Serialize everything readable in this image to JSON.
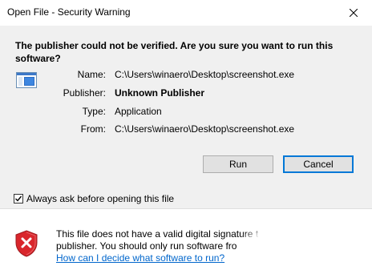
{
  "window": {
    "title": "Open File - Security Warning",
    "close_icon": "close-icon"
  },
  "headline": "The publisher could not be verified.  Are you sure you want to run this software?",
  "app_icon": "application-window-icon",
  "details": [
    {
      "label": "Name:",
      "value": "C:\\Users\\winaero\\Desktop\\screenshot.exe",
      "bold": false
    },
    {
      "label": "Publisher:",
      "value": "Unknown Publisher",
      "bold": true
    },
    {
      "label": "Type:",
      "value": "Application",
      "bold": false
    },
    {
      "label": "From:",
      "value": "C:\\Users\\winaero\\Desktop\\screenshot.exe",
      "bold": false
    }
  ],
  "buttons": {
    "run": "Run",
    "cancel": "Cancel"
  },
  "checkbox": {
    "label": "Always ask before opening this file",
    "checked": true
  },
  "warning": {
    "icon": "security-shield-x-icon",
    "line1": "This file does not have a valid digital signature t",
    "line2": "publisher.  You should only run software fro",
    "link": "How can I decide what software to run?"
  },
  "colors": {
    "link": "#0066cc",
    "default_button_border": "#0078d7",
    "shield_red": "#d9262c"
  }
}
